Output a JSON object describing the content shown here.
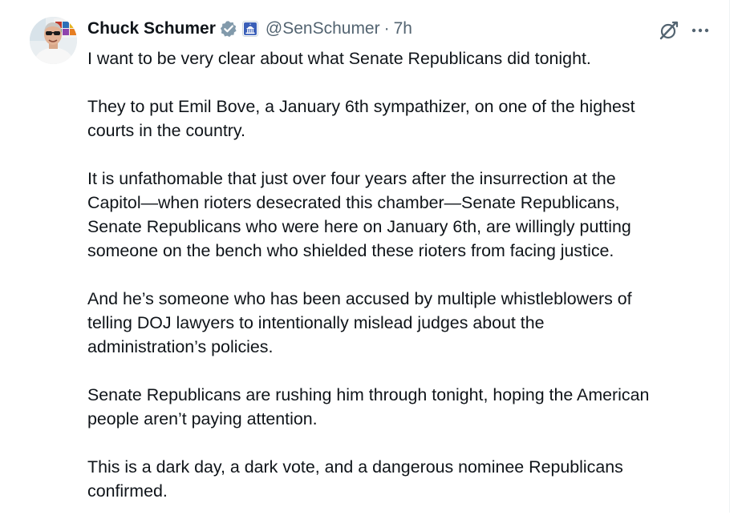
{
  "tweet": {
    "author": {
      "display_name": "Chuck Schumer",
      "handle": "@SenSchumer",
      "verified_icon": "verified-badge-icon",
      "affiliation_icon": "capitol-building-badge-icon"
    },
    "separator": "·",
    "time": "7h",
    "actions": {
      "grok_icon": "grok-icon",
      "more_icon": "more-options-icon"
    },
    "paragraphs": [
      "I want to be very clear about what Senate Republicans did tonight.",
      "They to put Emil Bove, a January 6th sympathizer, on one of the highest\ncourts in the country.",
      "It is unfathomable that just over four years after the insurrection at the\nCapitol—when rioters desecrated this chamber—Senate Republicans,\nSenate Republicans who were here on January 6th, are willingly putting\nsomeone on the bench who shielded these rioters from facing justice.",
      "And he’s someone who has been accused by multiple whistleblowers of\ntelling DOJ lawyers to intentionally mislead judges about the\nadministration’s policies.",
      "Senate Republicans are rushing him through tonight, hoping the American\npeople aren’t paying attention.",
      "This is a dark day, a dark vote, and a dangerous nominee Republicans\nconfirmed."
    ]
  },
  "colors": {
    "text": "#0f1419",
    "secondary": "#536471",
    "verified_gray": "#829aab",
    "divider": "#eff3f4"
  }
}
